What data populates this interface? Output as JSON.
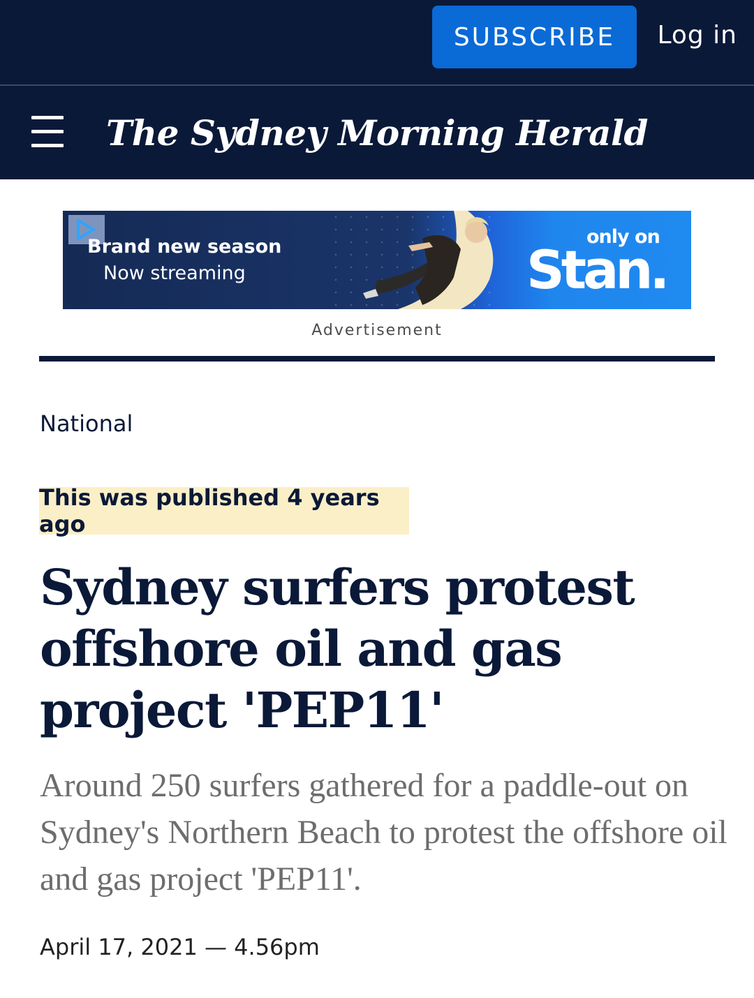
{
  "header": {
    "subscribe_label": "SUBSCRIBE",
    "login_label": "Log in",
    "masthead": "The Sydney Morning Herald"
  },
  "advertisement": {
    "headline": "Brand new season",
    "subline": "Now streaming",
    "only_on": "only on",
    "brand": "Stan.",
    "label": "Advertisement"
  },
  "article": {
    "section": "National",
    "published_badge": "This was published 4 years ago",
    "title": "Sydney surfers protest offshore oil and gas project 'PEP11'",
    "standfirst": "Around 250 surfers gathered for a paddle-out on Sydney's Northern Beach to protest the offshore oil and gas project 'PEP11'.",
    "date": "April 17, 2021 — 4.56pm"
  },
  "colors": {
    "navy": "#0b1938",
    "subscribe_blue": "#0a6ad6",
    "badge_yellow": "#fbefc7",
    "ad_blue": "#1f8af0"
  },
  "icons": {
    "menu": "hamburger-menu-icon",
    "ad_play": "play-icon"
  }
}
